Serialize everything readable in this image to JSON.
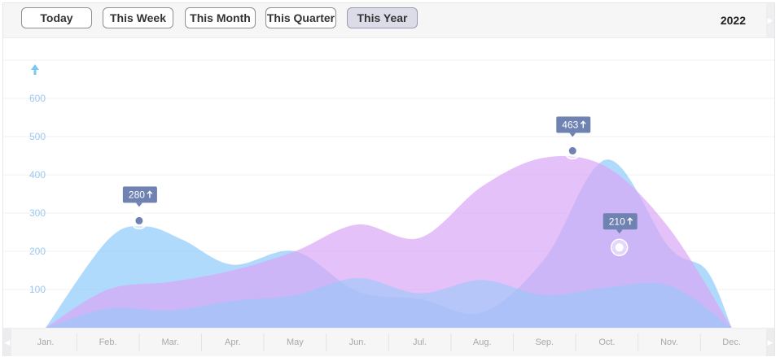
{
  "toolbar": {
    "buttons": [
      {
        "label": "Today",
        "active": false
      },
      {
        "label": "This Week",
        "active": false
      },
      {
        "label": "This Month",
        "active": false
      },
      {
        "label": "This Quarter",
        "active": false
      },
      {
        "label": "This Year",
        "active": true
      }
    ],
    "year": "2022"
  },
  "icons": {
    "axis_arrow": "up-arrow-icon",
    "scroll_left": "chevron-left-icon",
    "scroll_right": "chevron-right-icon"
  },
  "colors": {
    "series_blue": "#8fcbf9",
    "series_purple": "#d9a7f5",
    "callout": "#6f82b2",
    "axis_icon": "#7cc6f2"
  },
  "chart_data": {
    "type": "area",
    "categories": [
      "Jan.",
      "Feb.",
      "Mar.",
      "Apr.",
      "May",
      "Jun.",
      "Jul.",
      "Aug.",
      "Sep.",
      "Oct.",
      "Nov.",
      "Dec."
    ],
    "series": [
      {
        "x": [
          0,
          1,
          1.6,
          2.2,
          3,
          4,
          5,
          6,
          7,
          8,
          9,
          10,
          10.6,
          11
        ],
        "values": [
          0,
          230,
          265,
          230,
          165,
          200,
          95,
          75,
          40,
          180,
          440,
          210,
          150,
          0
        ]
      },
      {
        "x": [
          0,
          1,
          2,
          3,
          4,
          5,
          6,
          7,
          8,
          9,
          10,
          11
        ],
        "values": [
          0,
          100,
          120,
          150,
          200,
          270,
          235,
          370,
          445,
          420,
          260,
          0
        ]
      },
      {
        "x": [
          0,
          1,
          2,
          3,
          4,
          5,
          6,
          7,
          8,
          9,
          10,
          11
        ],
        "values": [
          0,
          50,
          45,
          70,
          85,
          130,
          90,
          125,
          85,
          105,
          110,
          0
        ]
      }
    ],
    "yticks": [
      100,
      200,
      300,
      400,
      500,
      600
    ],
    "ylim": [
      0,
      700
    ],
    "highlights": [
      {
        "month": "Feb.",
        "x": 1.5,
        "value": 280,
        "label": "280"
      },
      {
        "month": "Sep.",
        "x": 8.45,
        "value": 463,
        "label": "463"
      },
      {
        "month": "Oct.",
        "x": 9.2,
        "value": 210,
        "label": "210"
      }
    ]
  }
}
